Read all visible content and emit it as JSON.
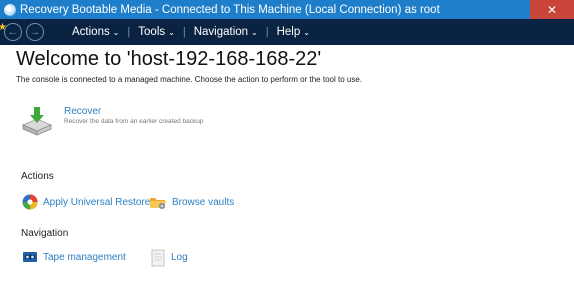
{
  "window": {
    "title": "Recovery Bootable Media - Connected to This Machine (Local Connection) as root",
    "close_glyph": "✕"
  },
  "menubar": {
    "star_glyph": "★",
    "back_glyph": "←",
    "forward_glyph": "→",
    "items": [
      {
        "label": "Actions",
        "caret": "⌄"
      },
      {
        "label": "Tools",
        "caret": "⌄"
      },
      {
        "label": "Navigation",
        "caret": "⌄"
      },
      {
        "label": "Help",
        "caret": "⌄"
      }
    ],
    "separator": "|"
  },
  "main": {
    "title": "Welcome to 'host-192-168-168-22'",
    "subtitle": "The console is connected to a managed machine. Choose the action to perform or the tool to use.",
    "recover": {
      "label": "Recover",
      "description": "Recover the data from an earlier created backup",
      "icon": "recover-drive-arrow-icon"
    },
    "actions_section": {
      "label": "Actions",
      "items": [
        {
          "label": "Apply Universal Restore",
          "icon": "universal-restore-icon"
        },
        {
          "label": "Browse vaults",
          "icon": "folder-vault-icon"
        }
      ]
    },
    "navigation_section": {
      "label": "Navigation",
      "items": [
        {
          "label": "Tape management",
          "icon": "tape-icon"
        },
        {
          "label": "Log",
          "icon": "log-document-icon"
        }
      ]
    }
  },
  "colors": {
    "titlebar": "#1f7ec9",
    "menubar": "#0a2342",
    "link": "#2e7fc4",
    "close": "#c9453a"
  }
}
